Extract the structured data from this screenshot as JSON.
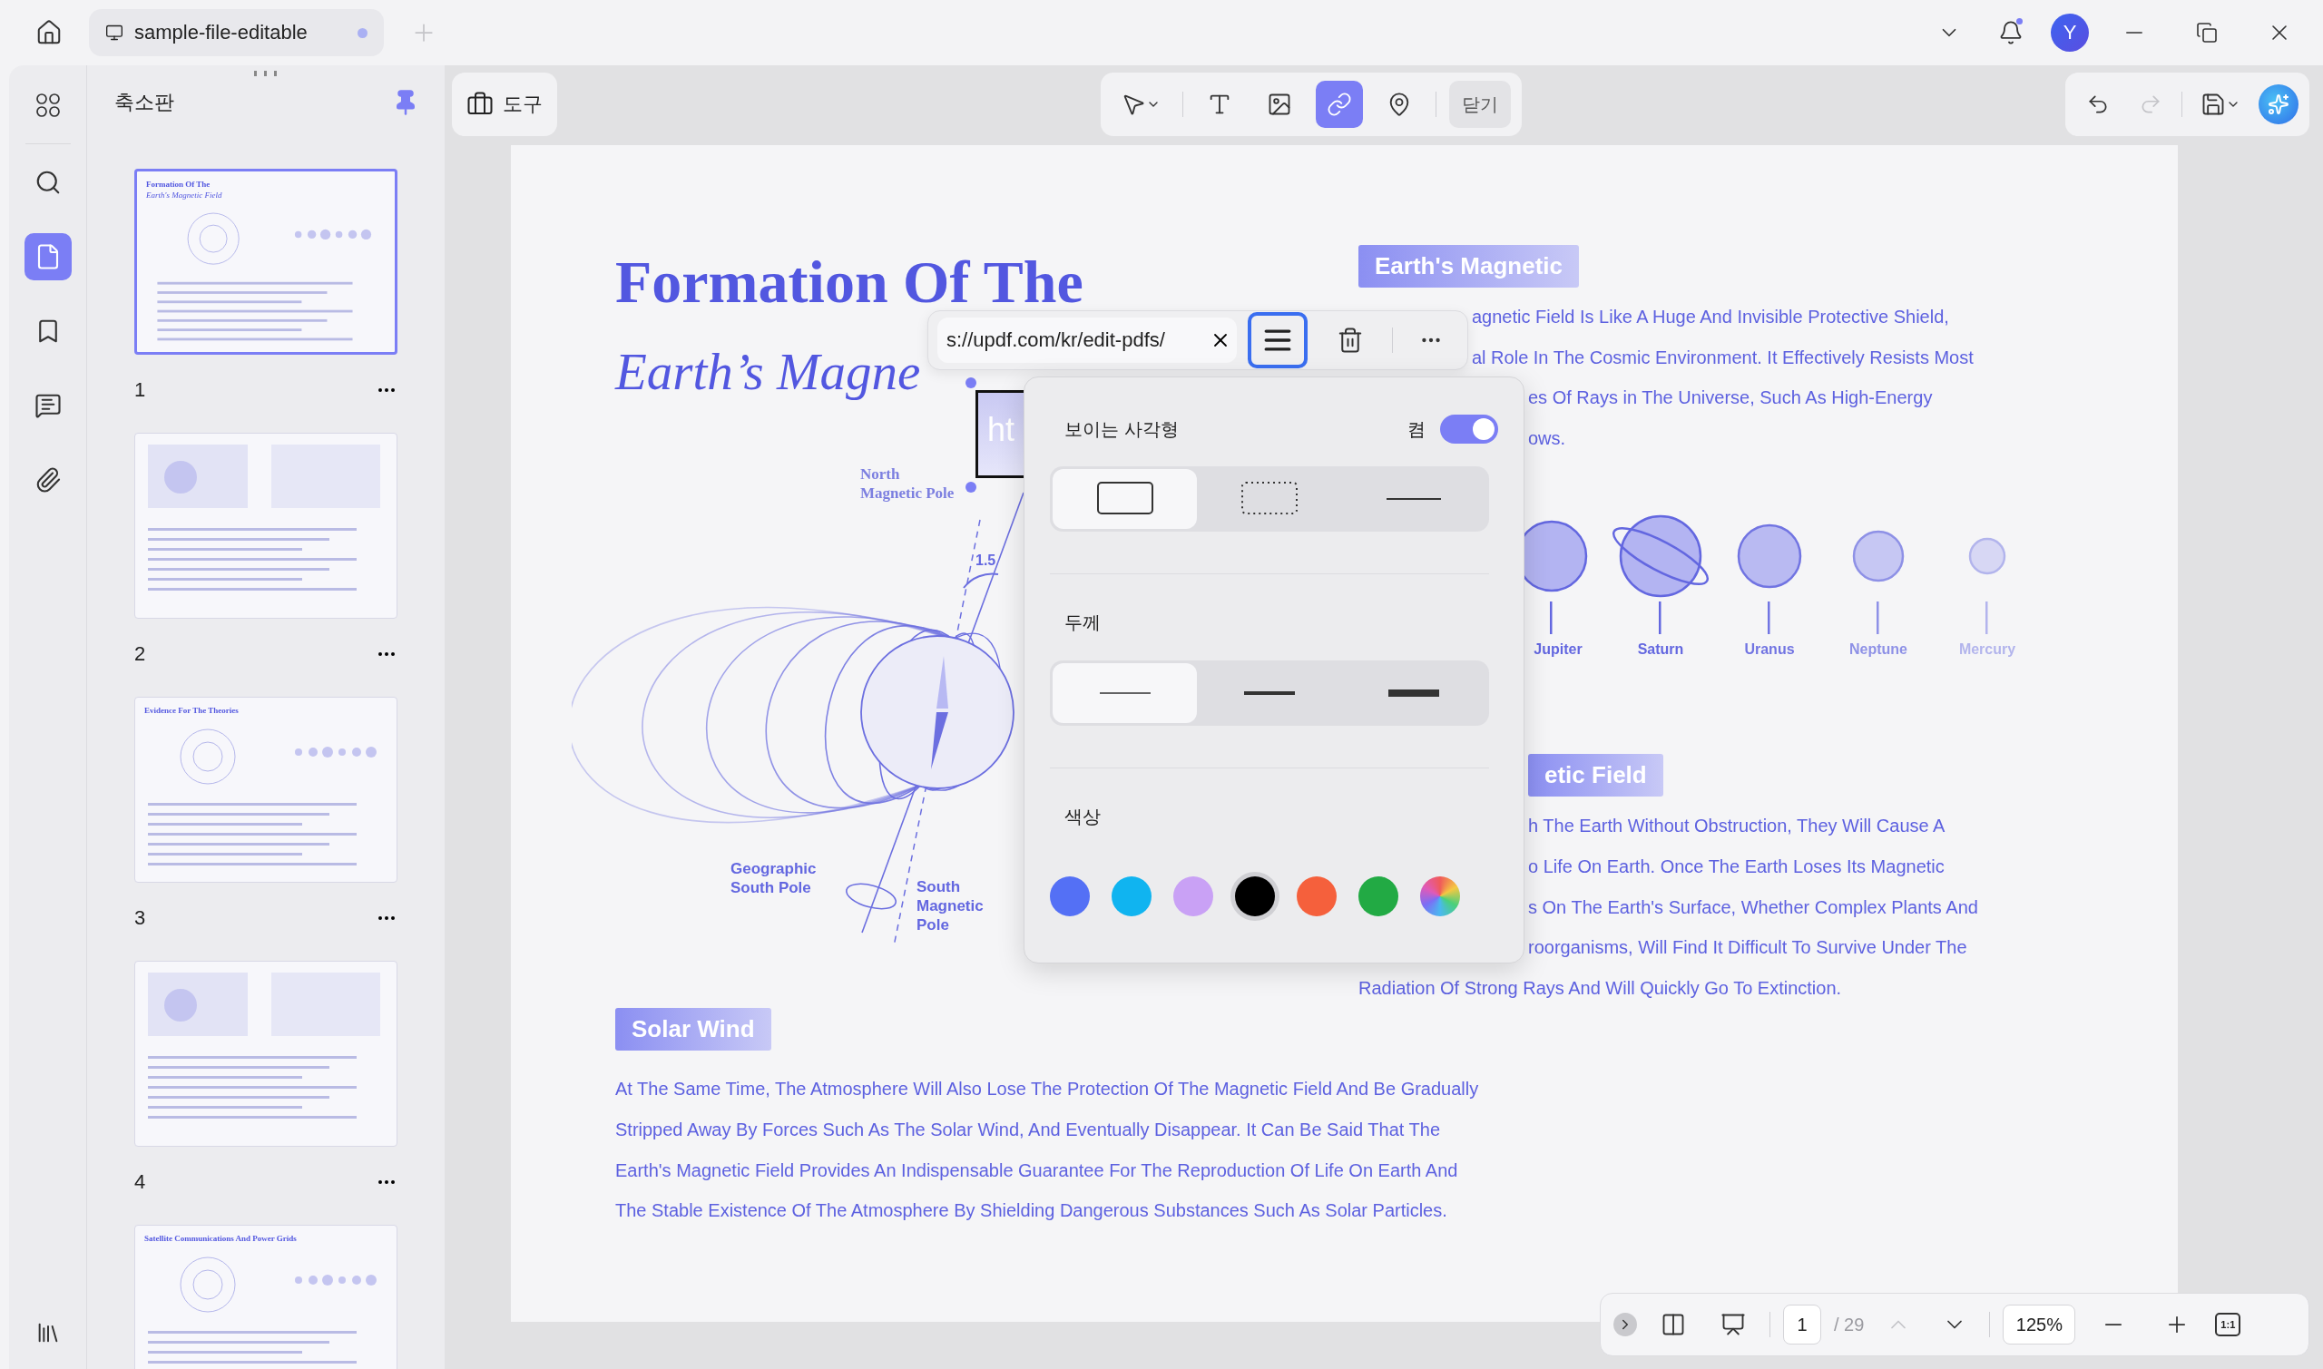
{
  "title_bar": {
    "tab": {
      "title": "sample-file-editable",
      "unsaved": true
    },
    "notification": true,
    "avatar": "Y"
  },
  "rail": {
    "items": [
      {
        "selected": false
      },
      {
        "selected": false
      },
      {
        "selected": true
      },
      {
        "selected": false
      },
      {
        "selected": false
      },
      {
        "selected": false
      }
    ]
  },
  "thumbnails": {
    "title": "축소판",
    "pinned": true,
    "pages": [
      {
        "number": "1",
        "selected": true,
        "heading": [
          "Formation Of The",
          "Earth's Magnetic Field"
        ]
      },
      {
        "number": "2",
        "selected": false
      },
      {
        "number": "3",
        "selected": false,
        "heading": [
          "Evidence For The Theories"
        ]
      },
      {
        "number": "4",
        "selected": false
      },
      {
        "selected": false,
        "heading": [
          "Satellite Communications And Power Grids"
        ]
      }
    ]
  },
  "toolbar": {
    "tools_button": "도구",
    "tools": [
      {
        "selected": false
      },
      {
        "selected": false
      },
      {
        "selected": false
      },
      {
        "selected": true
      },
      {
        "selected": false
      }
    ],
    "close_button": "닫기"
  },
  "document": {
    "title": "Formation Of The",
    "subtitle": "Earth’s Magne",
    "diagram": {
      "labels": [
        {
          "lines": [
            "North",
            "Magnetic Pole"
          ]
        },
        {
          "lines": [
            "1.5"
          ]
        },
        {
          "lines": [
            "Geographic",
            "South Pole"
          ]
        },
        {
          "lines": [
            "South",
            "Magnetic",
            "Pole"
          ]
        }
      ]
    },
    "link_box": {
      "text": "ht"
    },
    "section_1": {
      "header": "Earth's Magnetic",
      "lines": [
        "agnetic Field Is Like A Huge And Invisible Protective Shield,",
        "al Role In The Cosmic Environment. It Effectively Resists Most",
        "es Of Rays in The Universe, Such As High-Energy",
        "ows."
      ]
    },
    "planets": [
      {
        "name": "Jupiter",
        "kind": "plain"
      },
      {
        "name": "Saturn",
        "kind": "ringed"
      },
      {
        "name": "Uranus",
        "kind": "plain"
      },
      {
        "name": "Neptune",
        "kind": "plain"
      },
      {
        "name": "Mercury",
        "kind": "plain"
      }
    ],
    "section_2": {
      "header": "etic Field",
      "lines": [
        "h The Earth Without Obstruction, They Will Cause A",
        "o Life On Earth. Once The Earth Loses Its Magnetic",
        "s On The Earth's Surface, Whether Complex Plants And",
        "roorganisms, Will Find It Difficult To Survive Under The",
        "Radiation Of Strong Rays And Will Quickly Go To Extinction."
      ]
    },
    "section_3": {
      "header": "Solar Wind",
      "lines": [
        "At The Same Time, The Atmosphere Will Also Lose The Protection Of The Magnetic Field And Be Gradually",
        "Stripped Away By Forces Such As The Solar Wind, And Eventually Disappear. It Can Be Said That The",
        "Earth's Magnetic Field Provides An Indispensable Guarantee For The Reproduction Of Life On Earth And",
        "The Stable Existence Of The Atmosphere By Shielding Dangerous Substances Such As Solar Particles."
      ]
    }
  },
  "link_toolbar": {
    "url": "s://updf.com/kr/edit-pdfs/",
    "style_button_selected": true
  },
  "popover": {
    "visible_rect": {
      "label": "보이는 사각형",
      "state_label": "켬",
      "on": true
    },
    "styles": [
      {
        "selected": true
      },
      {
        "selected": false
      },
      {
        "selected": false
      }
    ],
    "thickness_label": "두께",
    "thickness": [
      {
        "selected": true
      },
      {
        "selected": false
      },
      {
        "selected": false
      }
    ],
    "color_label": "색상",
    "colors": [
      {
        "kind": "solid",
        "color": "#5470f5",
        "selected": false
      },
      {
        "kind": "solid",
        "color": "#10b4f0",
        "selected": false
      },
      {
        "kind": "solid",
        "color": "#c9a1f5",
        "selected": false
      },
      {
        "kind": "solid",
        "color": "#000000",
        "selected": true
      },
      {
        "kind": "solid",
        "color": "#f5603c",
        "selected": false
      },
      {
        "kind": "solid",
        "color": "#22aa44",
        "selected": false
      },
      {
        "kind": "gradient",
        "selected": false
      }
    ]
  },
  "page_nav": {
    "page": "1",
    "total": "/ 29",
    "prev_disabled": true,
    "zoom": "125%",
    "zoom_reset": "1:1"
  }
}
